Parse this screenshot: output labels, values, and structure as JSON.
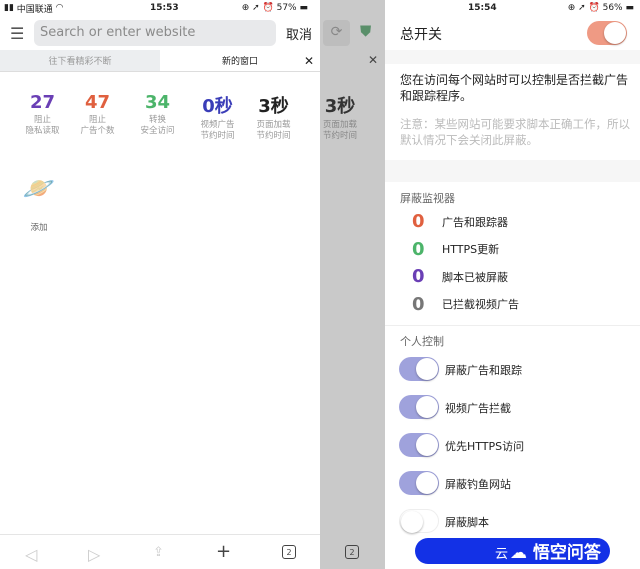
{
  "left": {
    "status": {
      "carrier": "中国联通",
      "time": "15:53",
      "battery": "57%"
    },
    "search": {
      "placeholder": "Search or enter website",
      "cancel": "取消"
    },
    "tabs": [
      {
        "label": "往下看精彩不断"
      },
      {
        "label": "新的窗口"
      }
    ],
    "stats": [
      {
        "value": "27",
        "label1": "阻止",
        "label2": "隐私读取",
        "color": "#6a3fb5"
      },
      {
        "value": "47",
        "label1": "阻止",
        "label2": "广告个数",
        "color": "#e0603f"
      },
      {
        "value": "34",
        "label1": "转换",
        "label2": "安全访问",
        "color": "#4cb46a"
      },
      {
        "value": "0秒",
        "label1": "视频广告",
        "label2": "节约时间",
        "color": "#3a3db8"
      },
      {
        "value": "3秒",
        "label1": "页面加载",
        "label2": "节约时间",
        "color": "#222222"
      }
    ],
    "shortcut": {
      "label": "添加"
    },
    "toolbar": {
      "tab_count": "2"
    }
  },
  "mid": {
    "stat_value": "3秒",
    "label1": "页面加载",
    "label2": "节约时间",
    "tab_count": "2"
  },
  "right": {
    "status": {
      "time": "15:54",
      "battery": "56%"
    },
    "master": {
      "label": "总开关",
      "on": true,
      "color": "#ef9a84"
    },
    "desc": "您在访问每个网站时可以控制是否拦截广告和跟踪程序。",
    "note": "注意：某些网站可能要求脚本正确工作，所以默认情况下会关闭此屏蔽。",
    "monitor": {
      "title": "屏蔽监视器",
      "items": [
        {
          "value": "0",
          "label": "广告和跟踪器",
          "color": "#e0603f"
        },
        {
          "value": "0",
          "label": "HTTPS更新",
          "color": "#4cb46a"
        },
        {
          "value": "0",
          "label": "脚本已被屏蔽",
          "color": "#6a3fb5"
        },
        {
          "value": "0",
          "label": "已拦截视频广告",
          "color": "#777777"
        }
      ]
    },
    "controls": {
      "title": "个人控制",
      "items": [
        {
          "label": "屏蔽广告和跟踪",
          "on": true
        },
        {
          "label": "视频广告拦截",
          "on": true
        },
        {
          "label": "优先HTTPS访问",
          "on": true
        },
        {
          "label": "屏蔽钓鱼网站",
          "on": true
        },
        {
          "label": "屏蔽脚本",
          "on": false
        }
      ]
    },
    "bottom_button": "云",
    "watermark": "悟空问答"
  }
}
